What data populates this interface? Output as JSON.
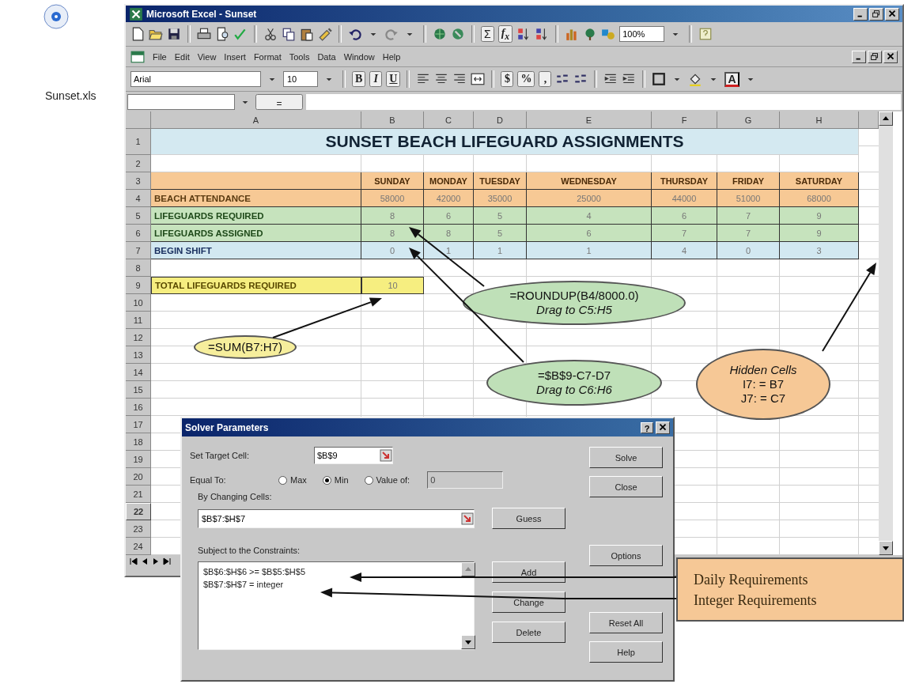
{
  "desktop_icon": {
    "label": "Sunset.xls"
  },
  "window": {
    "title": "Microsoft Excel - Sunset"
  },
  "standard_toolbar": {
    "autosum": "Σ",
    "function": "f$_{x}$",
    "zoom": "100%"
  },
  "menu_bar": [
    "File",
    "Edit",
    "View",
    "Insert",
    "Format",
    "Tools",
    "Data",
    "Window",
    "Help"
  ],
  "formatting_toolbar": {
    "font": "Arial",
    "size": "10",
    "bold": "B",
    "italic": "I",
    "underline": "U",
    "currency": "$",
    "percent": "%",
    "comma": ",",
    "font_color": "A"
  },
  "formula_bar": {
    "equals": "="
  },
  "sheet": {
    "columns": [
      "A",
      "B",
      "C",
      "D",
      "E",
      "F",
      "G",
      "H"
    ],
    "rows": [
      {
        "label": "1",
        "selected": false
      },
      {
        "label": "2",
        "selected": false
      },
      {
        "label": "3",
        "selected": false
      },
      {
        "label": "4",
        "selected": false
      },
      {
        "label": "5",
        "selected": false
      },
      {
        "label": "6",
        "selected": false
      },
      {
        "label": "7",
        "selected": false
      },
      {
        "label": "8",
        "selected": false
      },
      {
        "label": "9",
        "selected": false
      },
      {
        "label": "10",
        "selected": false
      },
      {
        "label": "11",
        "selected": false
      },
      {
        "label": "12",
        "selected": false
      },
      {
        "label": "13",
        "selected": false
      },
      {
        "label": "14",
        "selected": false
      },
      {
        "label": "15",
        "selected": false
      },
      {
        "label": "16",
        "selected": false
      },
      {
        "label": "17",
        "selected": false
      },
      {
        "label": "18",
        "selected": false
      },
      {
        "label": "19",
        "selected": false
      },
      {
        "label": "20",
        "selected": false
      },
      {
        "label": "21",
        "selected": false
      },
      {
        "label": "22",
        "selected": true
      },
      {
        "label": "23",
        "selected": false
      },
      {
        "label": "24",
        "selected": false
      }
    ]
  },
  "table": {
    "title": "SUNSET BEACH LIFEGUARD ASSIGNMENTS",
    "days": [
      "SUNDAY",
      "MONDAY",
      "TUESDAY",
      "WEDNESDAY",
      "THURSDAY",
      "FRIDAY",
      "SATURDAY"
    ],
    "rows": [
      {
        "kind": "attendance",
        "label": "BEACH ATTENDANCE",
        "values": [
          "58000",
          "42000",
          "35000",
          "25000",
          "44000",
          "51000",
          "68000"
        ]
      },
      {
        "kind": "required",
        "label": "LIFEGUARDS REQUIRED",
        "values": [
          "8",
          "6",
          "5",
          "4",
          "6",
          "7",
          "9"
        ]
      },
      {
        "kind": "assigned",
        "label": "LIFEGUARDS ASSIGNED",
        "values": [
          "8",
          "8",
          "5",
          "6",
          "7",
          "7",
          "9"
        ]
      },
      {
        "kind": "shift",
        "label": "BEGIN SHIFT",
        "values": [
          "0",
          "1",
          "1",
          "1",
          "4",
          "0",
          "3"
        ]
      }
    ],
    "total": {
      "label": "TOTAL LIFEGUARDS REQUIRED",
      "value": "10"
    }
  },
  "solver_dialog": {
    "title": "Solver Parameters",
    "help": "?",
    "target_label": "Set Target Cell:",
    "target": "$B$9",
    "equal_label": "Equal To:",
    "options": [
      {
        "label": "Max",
        "selected": false
      },
      {
        "label": "Min",
        "selected": true
      },
      {
        "label": "Value of:",
        "selected": false
      }
    ],
    "value_field": {
      "value": "0",
      "disabled": true
    },
    "changing_label": "By Changing Cells:",
    "changing": "$B$7:$H$7",
    "guess": "Guess",
    "constraints_label": "Subject to the Constraints:",
    "constraints": [
      "$B$6:$H$6 >= $B$5:$H$5",
      "$B$7:$H$7 = integer"
    ],
    "constraint_buttons": [
      "Add",
      "Change",
      "Delete"
    ],
    "side_buttons": [
      "Solve",
      "Close",
      "Options",
      "Reset All",
      "Help"
    ]
  },
  "callouts": [
    {
      "color": "#bfe0b8",
      "lines": [
        {
          "text": "=ROUNDUP(B4/8000.0)",
          "italic": false
        },
        {
          "text": "Drag to C5:H5",
          "italic": true
        }
      ]
    },
    {
      "color": "#bfe0b8",
      "lines": [
        {
          "text": "=$B$9-C7-D7",
          "italic": false
        },
        {
          "text": "Drag to C6:H6",
          "italic": true
        }
      ]
    },
    {
      "color": "#f6ee9c",
      "lines": [
        {
          "text": "=SUM(B7:H7)",
          "italic": false
        }
      ]
    },
    {
      "color": "#f6c896",
      "lines": [
        {
          "text": "Hidden Cells",
          "italic": true
        },
        {
          "text": "I7: = B7",
          "italic": false
        },
        {
          "text": "J7: = C7",
          "italic": false
        }
      ]
    }
  ],
  "note_box": {
    "lines": [
      "Daily Requirements",
      "Integer Requirements"
    ]
  }
}
